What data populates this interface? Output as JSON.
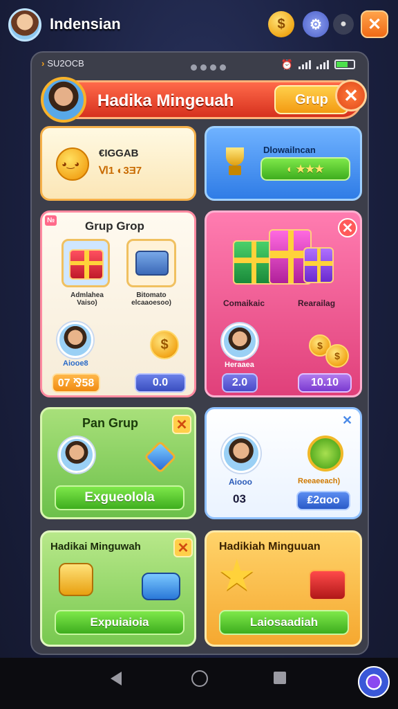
{
  "topbar": {
    "title": "Indensian"
  },
  "status": {
    "time": "SU2OCB"
  },
  "banner": {
    "title": "Hadika Mingeuah",
    "button": "Grup",
    "close": "✕"
  },
  "cards": {
    "c1": {
      "name": "€IGGAB",
      "sub": "Ⅵ1 ◐3Ǝ7"
    },
    "c2": {
      "title": "Dlowailncan",
      "pill": "◐ ★★★"
    },
    "c3": {
      "corner": "№",
      "title": "Grup Grop",
      "item1": "Admlahea\nVaiso)",
      "item2": "Bitomato\nelcaaoesoo)",
      "user": "Aiooe8",
      "pill_left": "07 ⅋58",
      "pill_right": "0.0"
    },
    "c4": {
      "label_left": "Comaikaic",
      "label_right": "Rearailag",
      "user": "Heraaea",
      "pill_left": "2.0",
      "pill_right": "10.10"
    },
    "c5": {
      "title": "Pan Grup",
      "button": "Exgueolola"
    },
    "c6": {
      "user": "Aiooo",
      "value": "03",
      "label": "Reeaeeach)",
      "pill": "₤2ɑoo"
    },
    "c7": {
      "title": "Hadikai Minguwah",
      "button": "Expuiaioia"
    },
    "c8": {
      "title": "Hadikiah Minguuan",
      "button": "Laiosaadiah"
    }
  },
  "colors": {
    "accent": "#f39a12",
    "banner": "#d6311e",
    "panel": "#3c3e4a"
  }
}
